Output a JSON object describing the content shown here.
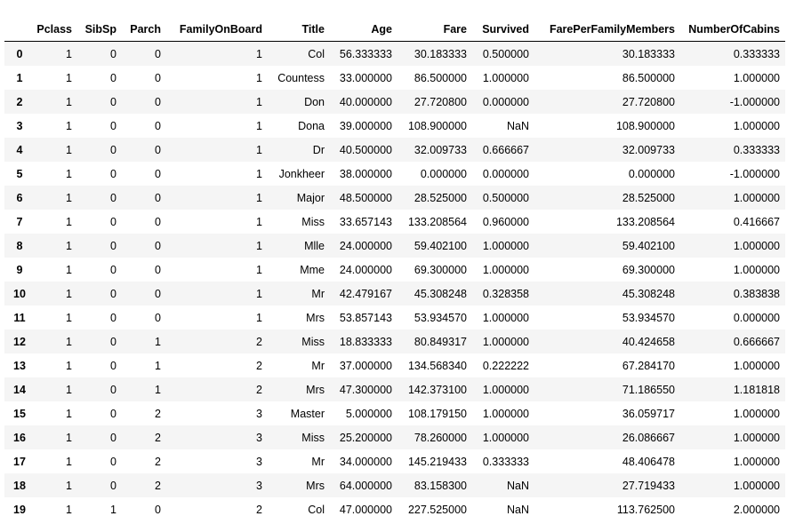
{
  "table": {
    "index_header": "",
    "columns": [
      "Pclass",
      "SibSp",
      "Parch",
      "FamilyOnBoard",
      "Title",
      "Age",
      "Fare",
      "Survived",
      "FarePerFamilyMembers",
      "NumberOfCabins"
    ],
    "rows": [
      {
        "index": "0",
        "cells": [
          "1",
          "0",
          "0",
          "1",
          "Col",
          "56.333333",
          "30.183333",
          "0.500000",
          "30.183333",
          "0.333333"
        ]
      },
      {
        "index": "1",
        "cells": [
          "1",
          "0",
          "0",
          "1",
          "Countess",
          "33.000000",
          "86.500000",
          "1.000000",
          "86.500000",
          "1.000000"
        ]
      },
      {
        "index": "2",
        "cells": [
          "1",
          "0",
          "0",
          "1",
          "Don",
          "40.000000",
          "27.720800",
          "0.000000",
          "27.720800",
          "-1.000000"
        ]
      },
      {
        "index": "3",
        "cells": [
          "1",
          "0",
          "0",
          "1",
          "Dona",
          "39.000000",
          "108.900000",
          "NaN",
          "108.900000",
          "1.000000"
        ]
      },
      {
        "index": "4",
        "cells": [
          "1",
          "0",
          "0",
          "1",
          "Dr",
          "40.500000",
          "32.009733",
          "0.666667",
          "32.009733",
          "0.333333"
        ]
      },
      {
        "index": "5",
        "cells": [
          "1",
          "0",
          "0",
          "1",
          "Jonkheer",
          "38.000000",
          "0.000000",
          "0.000000",
          "0.000000",
          "-1.000000"
        ]
      },
      {
        "index": "6",
        "cells": [
          "1",
          "0",
          "0",
          "1",
          "Major",
          "48.500000",
          "28.525000",
          "0.500000",
          "28.525000",
          "1.000000"
        ]
      },
      {
        "index": "7",
        "cells": [
          "1",
          "0",
          "0",
          "1",
          "Miss",
          "33.657143",
          "133.208564",
          "0.960000",
          "133.208564",
          "0.416667"
        ]
      },
      {
        "index": "8",
        "cells": [
          "1",
          "0",
          "0",
          "1",
          "Mlle",
          "24.000000",
          "59.402100",
          "1.000000",
          "59.402100",
          "1.000000"
        ]
      },
      {
        "index": "9",
        "cells": [
          "1",
          "0",
          "0",
          "1",
          "Mme",
          "24.000000",
          "69.300000",
          "1.000000",
          "69.300000",
          "1.000000"
        ]
      },
      {
        "index": "10",
        "cells": [
          "1",
          "0",
          "0",
          "1",
          "Mr",
          "42.479167",
          "45.308248",
          "0.328358",
          "45.308248",
          "0.383838"
        ]
      },
      {
        "index": "11",
        "cells": [
          "1",
          "0",
          "0",
          "1",
          "Mrs",
          "53.857143",
          "53.934570",
          "1.000000",
          "53.934570",
          "0.000000"
        ]
      },
      {
        "index": "12",
        "cells": [
          "1",
          "0",
          "1",
          "2",
          "Miss",
          "18.833333",
          "80.849317",
          "1.000000",
          "40.424658",
          "0.666667"
        ]
      },
      {
        "index": "13",
        "cells": [
          "1",
          "0",
          "1",
          "2",
          "Mr",
          "37.000000",
          "134.568340",
          "0.222222",
          "67.284170",
          "1.000000"
        ]
      },
      {
        "index": "14",
        "cells": [
          "1",
          "0",
          "1",
          "2",
          "Mrs",
          "47.300000",
          "142.373100",
          "1.000000",
          "71.186550",
          "1.181818"
        ]
      },
      {
        "index": "15",
        "cells": [
          "1",
          "0",
          "2",
          "3",
          "Master",
          "5.000000",
          "108.179150",
          "1.000000",
          "36.059717",
          "1.000000"
        ]
      },
      {
        "index": "16",
        "cells": [
          "1",
          "0",
          "2",
          "3",
          "Miss",
          "25.200000",
          "78.260000",
          "1.000000",
          "26.086667",
          "1.000000"
        ]
      },
      {
        "index": "17",
        "cells": [
          "1",
          "0",
          "2",
          "3",
          "Mr",
          "34.000000",
          "145.219433",
          "0.333333",
          "48.406478",
          "1.000000"
        ]
      },
      {
        "index": "18",
        "cells": [
          "1",
          "0",
          "2",
          "3",
          "Mrs",
          "64.000000",
          "83.158300",
          "NaN",
          "27.719433",
          "1.000000"
        ]
      },
      {
        "index": "19",
        "cells": [
          "1",
          "1",
          "0",
          "2",
          "Col",
          "47.000000",
          "227.525000",
          "NaN",
          "113.762500",
          "2.000000"
        ]
      }
    ]
  }
}
